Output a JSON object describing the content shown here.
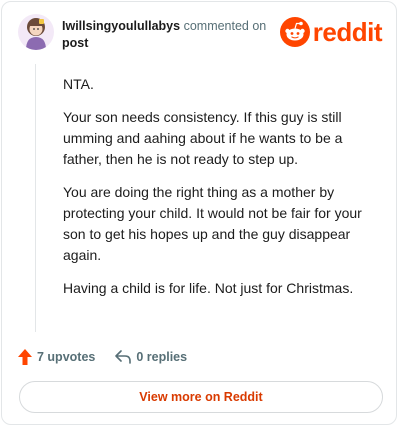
{
  "header": {
    "username": "Iwillsingyoulullabys",
    "action_text": "commented on",
    "post_link": "post",
    "brand": "reddit"
  },
  "comment": {
    "paragraphs": [
      "NTA.",
      "Your son needs consistency. If this guy is still umming and aahing about if he wants to be a father, then he is not ready to step up.",
      "You are doing the right thing as a mother by protecting your child. It would not be fair for your son to get his hopes up and the guy disappear again.",
      "Having a child is for life. Not just for Christmas."
    ]
  },
  "actions": {
    "upvotes": "7 upvotes",
    "replies": "0 replies"
  },
  "footer": {
    "view_more": "View more on Reddit"
  },
  "colors": {
    "brand": "#ff4500",
    "muted": "#576f76",
    "view_more": "#d93a00"
  },
  "icons": [
    "avatar",
    "reddit-logo-icon",
    "upvote-arrow-icon",
    "reply-icon"
  ]
}
